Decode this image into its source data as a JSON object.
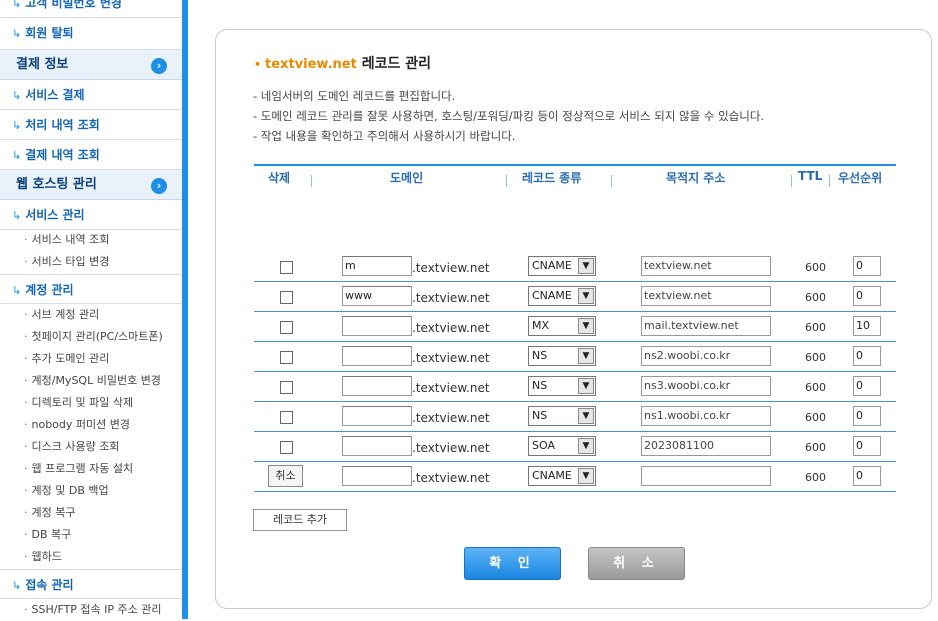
{
  "sidebar": {
    "top_partial": "고객 비밀번호 변경",
    "withdraw": "회원 탈퇴",
    "payment_section": "결제 정보",
    "service_payment": "서비스 결제",
    "processing_history": "처리 내역 조회",
    "payment_history": "결제 내역 조회",
    "hosting_section": "웹 호스팅 관리",
    "service_manage": "서비스 관리",
    "service_leaves": [
      "서비스 내역 조회",
      "서비스 타입 변경"
    ],
    "account_manage": "계정 관리",
    "account_leaves": [
      "서브 계정 관리",
      "첫페이지 관리(PC/스마트폰)",
      "추가 도메인 관리",
      "계정/MySQL 비밀번호 변경",
      "디렉토리 및 파일 삭제",
      "nobody 퍼미션 변경",
      "디스크 사용량 조회",
      "웹 프로그램 자동 설치",
      "계정 및 DB 백업",
      "계정 복구",
      "DB 복구",
      "웹하드"
    ],
    "access_manage": "접속 관리",
    "access_leaves": [
      "SSH/FTP 접속 IP 주소 관리"
    ],
    "section_icon": "chevron-right-circle-icon",
    "accent": "#1e8ee6"
  },
  "header": {
    "domain": "textview.net",
    "title": "레코드 관리"
  },
  "notes": [
    "- 네임서버의 도메인 레코드를 편집합니다.",
    "- 도메인 레코드 관리를 잘못 사용하면, 호스팅/포워딩/파킹 등이 정상적으로 서비스 되지 않을 수 있습니다.",
    "- 작업 내용을 확인하고 주의해서 사용하시기 바랍니다."
  ],
  "table": {
    "headers": {
      "delete": "삭제",
      "domain": "도메인",
      "type": "레코드 종류",
      "target": "목적지 주소",
      "ttl": "TTL",
      "priority": "우선순위"
    },
    "domain_suffix": ".textview.net",
    "cancel_label": "취소",
    "rows": [
      {
        "host": "m",
        "type": "CNAME",
        "target": "textview.net",
        "ttl": "600",
        "priority": "0"
      },
      {
        "host": "www",
        "type": "CNAME",
        "target": "textview.net",
        "ttl": "600",
        "priority": "0"
      },
      {
        "host": "",
        "type": "MX",
        "target": "mail.textview.net",
        "ttl": "600",
        "priority": "10"
      },
      {
        "host": "",
        "type": "NS",
        "target": "ns2.woobi.co.kr",
        "ttl": "600",
        "priority": "0"
      },
      {
        "host": "",
        "type": "NS",
        "target": "ns3.woobi.co.kr",
        "ttl": "600",
        "priority": "0"
      },
      {
        "host": "",
        "type": "NS",
        "target": "ns1.woobi.co.kr",
        "ttl": "600",
        "priority": "0"
      },
      {
        "host": "",
        "type": "SOA",
        "target": "2023081100",
        "ttl": "600",
        "priority": "0"
      },
      {
        "host": "",
        "type": "CNAME",
        "target": "",
        "ttl": "600",
        "priority": "0"
      }
    ]
  },
  "buttons": {
    "add_record": "레코드 추가",
    "confirm": "확 인",
    "cancel": "취 소"
  },
  "colors": {
    "brand_blue": "#1e8ee6",
    "domain_orange": "#e88a00"
  }
}
